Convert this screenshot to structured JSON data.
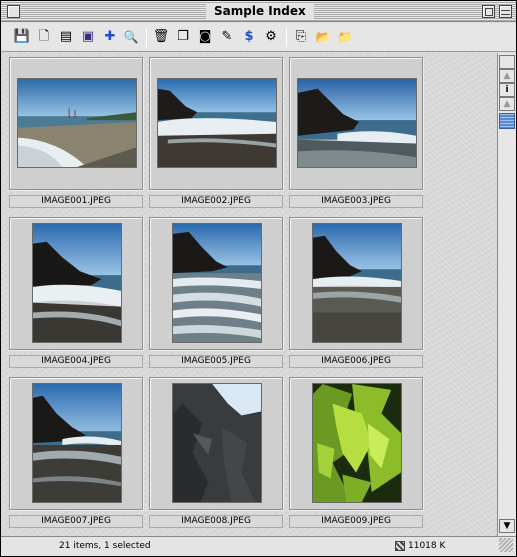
{
  "window": {
    "title": "Sample Index"
  },
  "toolbar": {
    "buttons": [
      {
        "name": "save-disk-icon",
        "glyph": "💾"
      },
      {
        "name": "page-icon",
        "glyph": "🗋"
      },
      {
        "name": "card-icon",
        "glyph": "▤"
      },
      {
        "name": "picture-window-icon",
        "glyph": "▣"
      },
      {
        "name": "plus-icon",
        "glyph": "✚"
      },
      {
        "name": "magnifier-icon",
        "glyph": "🔍"
      },
      {
        "name": "trash-icon",
        "glyph": "🗑"
      },
      {
        "name": "stack-icon",
        "glyph": "❐"
      },
      {
        "name": "frame-icon",
        "glyph": "◙"
      },
      {
        "name": "edit-pencil-icon",
        "glyph": "✎"
      },
      {
        "name": "dollar-icon",
        "glyph": "$"
      },
      {
        "name": "gear-icon",
        "glyph": "⚙"
      },
      {
        "name": "export-icon",
        "glyph": "⎘"
      },
      {
        "name": "folder-download-icon",
        "glyph": "📂"
      },
      {
        "name": "folder-upload-icon",
        "glyph": "📁"
      }
    ]
  },
  "items": [
    {
      "name": "IMAGE001.JPEG"
    },
    {
      "name": "IMAGE002.JPEG"
    },
    {
      "name": "IMAGE003.JPEG"
    },
    {
      "name": "IMAGE004.JPEG"
    },
    {
      "name": "IMAGE005.JPEG"
    },
    {
      "name": "IMAGE006.JPEG"
    },
    {
      "name": "IMAGE007.JPEG"
    },
    {
      "name": "IMAGE008.JPEG"
    },
    {
      "name": "IMAGE009.JPEG"
    }
  ],
  "scrollbar": {
    "info_glyph": "i",
    "up_glyph": "▲",
    "down_glyph": "▼"
  },
  "status": {
    "count_text": "21 items, 1 selected",
    "size_text": "11018 K"
  },
  "colors": {
    "accent": "#3c5fa3",
    "selection": "#7fa9e0"
  }
}
